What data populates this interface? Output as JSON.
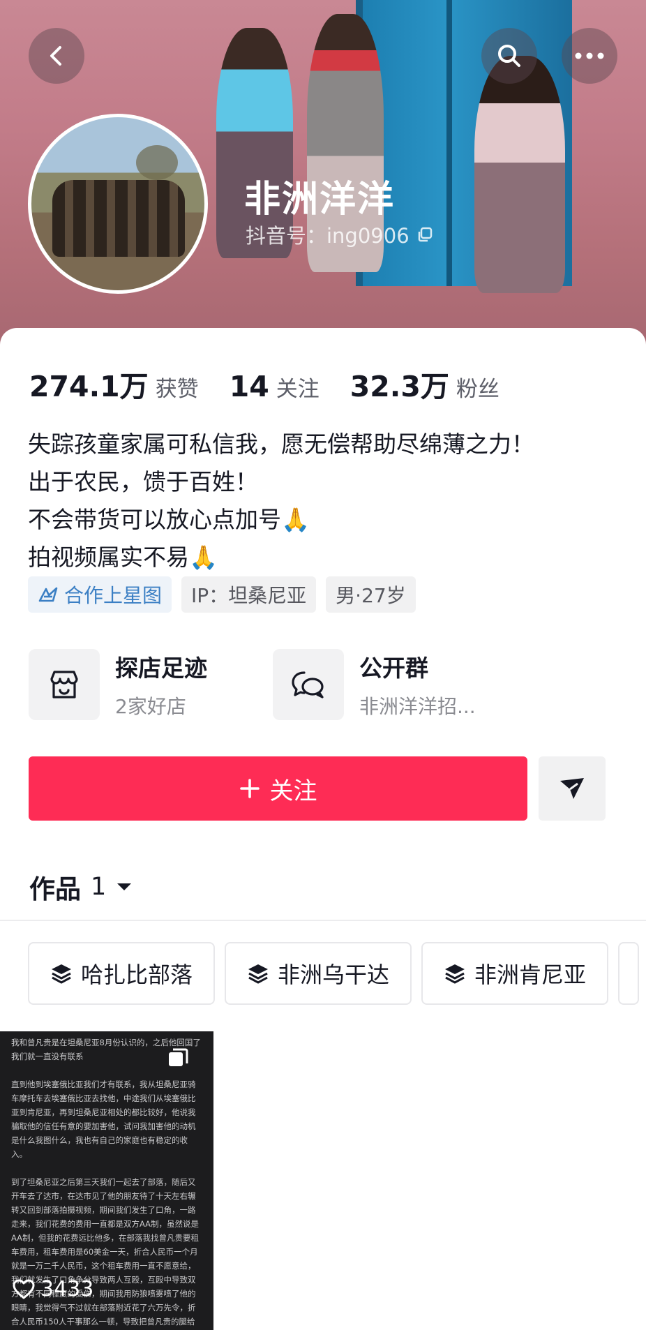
{
  "profile": {
    "name": "非洲洋洋",
    "douyin_id": "抖音号：ing0906"
  },
  "stats": [
    {
      "value": "274.1万",
      "label": "获赞"
    },
    {
      "value": "14",
      "label": "关注"
    },
    {
      "value": "32.3万",
      "label": "粉丝"
    }
  ],
  "bio": {
    "line1": "失踪孩童家属可私信我，愿无偿帮助尽绵薄之力！",
    "line2": "出于农民，馈于百姓！",
    "line3": "不会带货可以放心点加号🙏",
    "line4": "拍视频属实不易🙏"
  },
  "tags": {
    "star": "合作上星图",
    "ip": "IP：坦桑尼亚",
    "gender_age": "男·27岁"
  },
  "cards": {
    "shop_title": "探店足迹",
    "shop_sub": "2家好店",
    "group_title": "公开群",
    "group_sub": "非洲洋洋招..."
  },
  "actions": {
    "follow_label": "关注"
  },
  "works": {
    "label": "作品",
    "count": "1"
  },
  "collections": [
    "哈扎比部落",
    "非洲乌干达",
    "非洲肯尼亚"
  ],
  "video": {
    "likes": "3433",
    "text_p1": "我和曾凡贵是在坦桑尼亚8月份认识的，之后他回国了我们就一直没有联系",
    "text_p2": "直到他到埃塞俄比亚我们才有联系，我从坦桑尼亚骑车摩托车去埃塞俄比亚去找他，中途我们从埃塞俄比亚到肯尼亚，再到坦桑尼亚相处的都比较好，他说我骗取他的信任有意的要加害他，试问我加害他的动机是什么我图什么，我也有自己的家庭也有稳定的收入。",
    "text_p3": "到了坦桑尼亚之后第三天我们一起去了部落，随后又开车去了达市，在达市见了他的朋友待了十天左右辗转又回到部落拍摄视频，期间我们发生了口角，一路走来，我们花费的费用一直都是双方AA制，虽然说是AA制，但我的花费远比他多，在部落我找曾凡贵要租车费用，租车费用是60美金一天，折合人民币一个月就是一万二千人民币，这个租车费用一直不愿意给，我们就发生了口角争分导致两人互殴，互殴中导致双方都有不同程度的受伤，期间我用防狼喷雾喷了他的眼睛，我觉得气不过就在部落附近花了六万先令，折合人民币150人干事那么一顿，导致把曾凡贵的腿给打折了，"
  },
  "colors": {
    "accent": "#fe2c55",
    "star_blue": "#3b7fc4",
    "text_primary": "#161823",
    "text_secondary": "#5d5f69"
  },
  "icons": [
    "back-arrow-icon",
    "search-icon",
    "more-icon",
    "copy-icon",
    "star-map-icon",
    "shop-icon",
    "chat-group-icon",
    "plus-icon",
    "send-icon",
    "caret-down-icon",
    "layers-icon",
    "heart-icon",
    "multi-image-icon"
  ]
}
